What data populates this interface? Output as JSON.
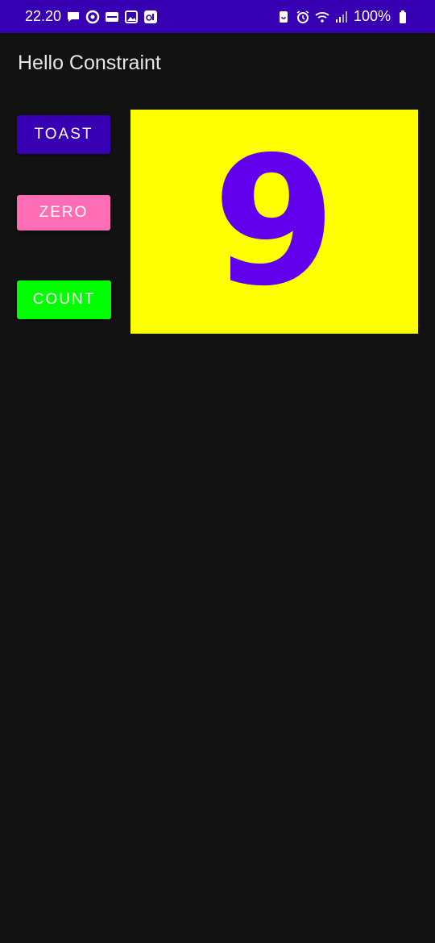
{
  "status_bar": {
    "time": "22.20",
    "battery": "100%",
    "background": "#3700b3",
    "left_icons": [
      "chat-icon",
      "app-circle-icon",
      "news-icon",
      "gallery-icon",
      "app-badge-icon"
    ],
    "right_icons": [
      "battery-saver-icon",
      "alarm-icon",
      "wifi-icon",
      "signal-icon",
      "battery-icon"
    ]
  },
  "app_bar": {
    "title": "Hello Constraint"
  },
  "buttons": {
    "toast": {
      "label": "TOAST",
      "color": "#3700b3"
    },
    "zero": {
      "label": "ZERO",
      "color": "#ff6eb4"
    },
    "count": {
      "label": "COUNT",
      "color": "#00ff00"
    }
  },
  "counter": {
    "value": "9",
    "background": "#ffff00",
    "text_color": "#6200ee"
  },
  "theme": {
    "background": "#121212"
  }
}
